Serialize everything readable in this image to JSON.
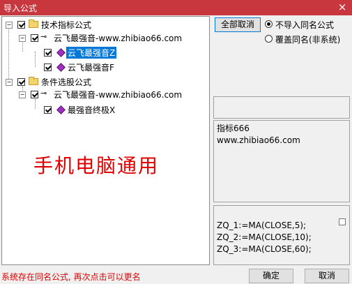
{
  "window": {
    "title": "导入公式",
    "close_glyph": "×"
  },
  "tree": {
    "groups": [
      {
        "label": "技术指标公式",
        "author": "云飞最强音-www.zhibiao66.com",
        "items": [
          "云飞最强音Z",
          "云飞最强音F"
        ],
        "selected_item": "云飞最强音Z"
      },
      {
        "label": "条件选股公式",
        "author": "云飞最强音-www.zhibiao66.com",
        "items": [
          "最强音终极X"
        ]
      }
    ]
  },
  "overlay_text": "手机电脑通用",
  "toolbar": {
    "deselect_all": "全部取消"
  },
  "options": [
    {
      "label": "不导入同名公式",
      "selected": true
    },
    {
      "label": "覆盖同名(非系统)",
      "selected": false
    }
  ],
  "info": {
    "line1": "指标666",
    "line2": "www.zhibiao66.com"
  },
  "code": {
    "line1": "ZQ_1:=MA(CLOSE,5);",
    "line2": "ZQ_2:=MA(CLOSE,10);",
    "line3": "ZQ_3:=MA(CLOSE,60);"
  },
  "status": "系统存在同名公式, 再次点击可以更名",
  "buttons": {
    "ok": "确定",
    "cancel": "取消"
  },
  "colors": {
    "titlebar": "#c8363e",
    "accent_text": "#e00000",
    "selection": "#0078d7",
    "formula_icon": "#a030c0"
  }
}
